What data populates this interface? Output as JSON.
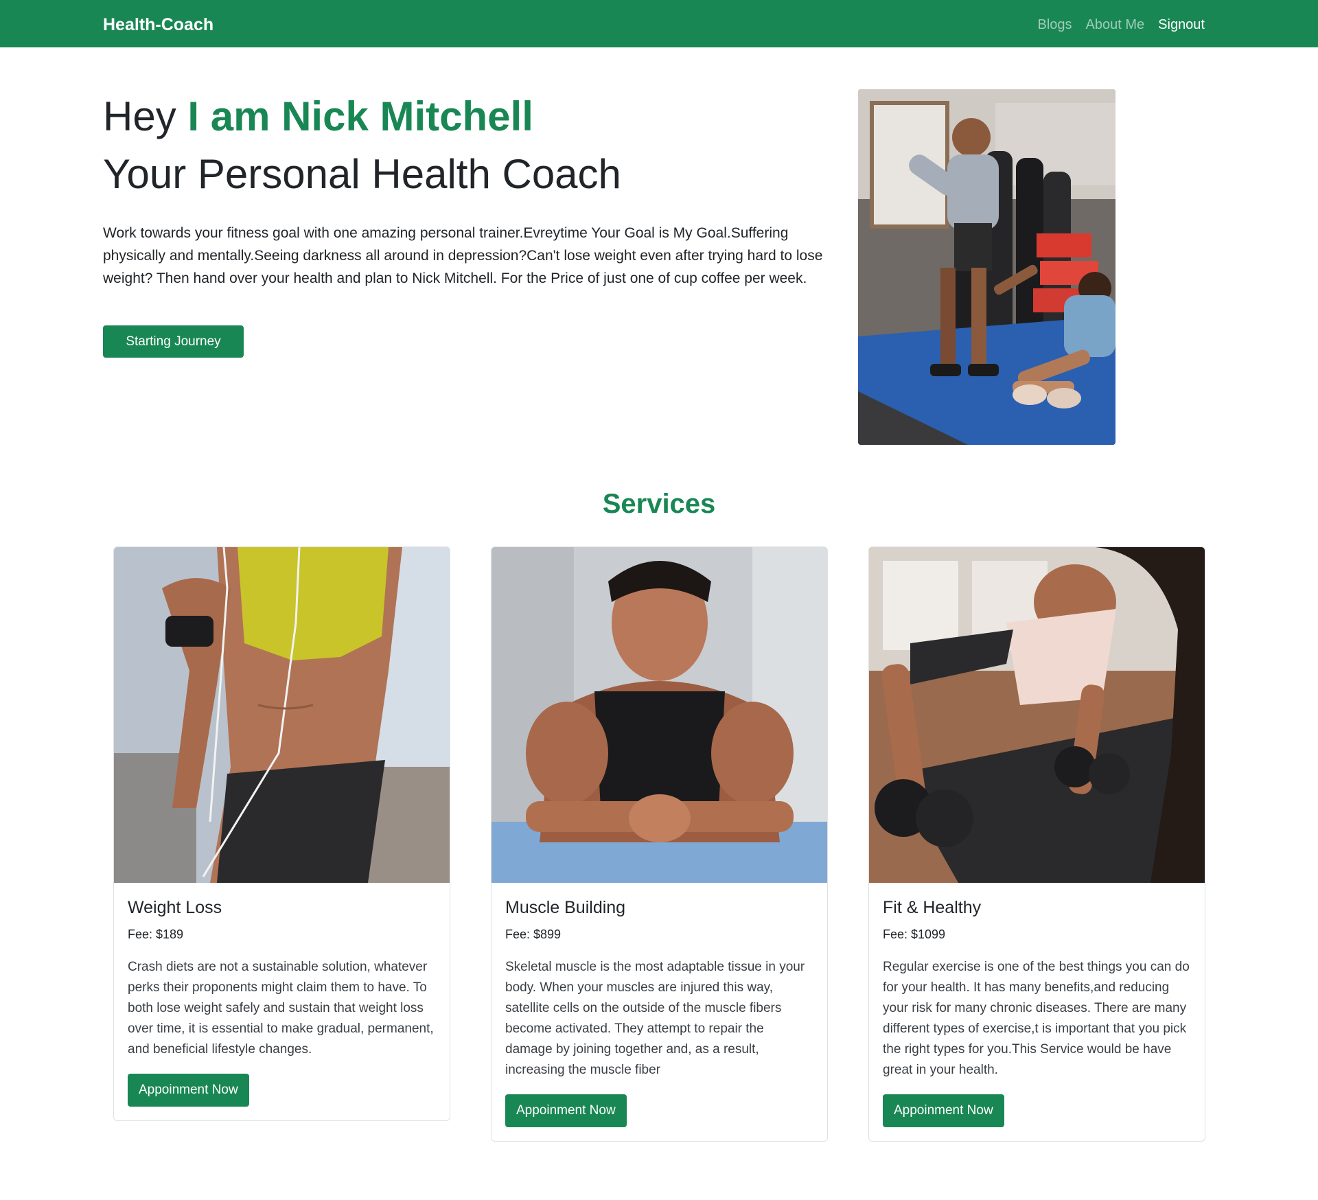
{
  "navbar": {
    "brand": "Health-Coach",
    "links": [
      {
        "label": "Blogs"
      },
      {
        "label": "About Me"
      },
      {
        "label": "Signout"
      }
    ]
  },
  "hero": {
    "greeting": "Hey ",
    "name": "I am Nick Mitchell",
    "subtitle": "Your Personal Health Coach",
    "description": "Work towards your fitness goal with one amazing personal trainer.Evreytime Your Goal is My Goal.Suffering physically and mentally.Seeing darkness all around in depression?Can't lose weight even after trying hard to lose weight? Then hand over your health and plan to Nick Mitchell. For the Price of just one of cup coffee per week.",
    "button_label": "Starting Journey"
  },
  "services": {
    "title": "Services",
    "cards": [
      {
        "title": "Weight Loss",
        "fee": "Fee: $189",
        "text": "Crash diets are not a sustainable solution, whatever perks their proponents might claim them to have. To both lose weight safely and sustain that weight loss over time, it is essential to make gradual, permanent, and beneficial lifestyle changes.",
        "button_label": "Appoinment Now"
      },
      {
        "title": "Muscle Building",
        "fee": "Fee: $899",
        "text": "Skeletal muscle is the most adaptable tissue in your body. When your muscles are injured this way, satellite cells on the outside of the muscle fibers become activated. They attempt to repair the damage by joining together and, as a result, increasing the muscle fiber",
        "button_label": "Appoinment Now"
      },
      {
        "title": "Fit & Healthy",
        "fee": "Fee: $1099",
        "text": "Regular exercise is one of the best things you can do for your health. It has many benefits,and reducing your risk for many chronic diseases. There are many different types of exercise,t is important that you pick the right types for you.This Service would be have great in your health.",
        "button_label": "Appoinment Now"
      }
    ]
  },
  "colors": {
    "brand_green": "#198754",
    "text_dark": "#212529"
  }
}
